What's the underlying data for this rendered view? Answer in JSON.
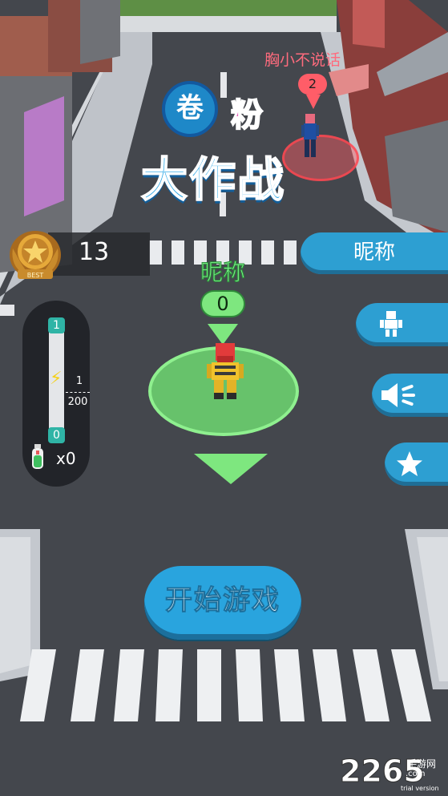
{
  "title": {
    "circle_char": "卷",
    "line1_char": "粉",
    "line2": "大作战"
  },
  "opponent": {
    "name": "胸小不说话",
    "score": "2"
  },
  "best_score": {
    "badge_text": "BEST",
    "value": "13"
  },
  "energy": {
    "max_label": "1",
    "min_label": "0",
    "fraction_numerator": "1",
    "fraction_denominator": "200",
    "level_fraction": 0.005
  },
  "potion": {
    "count": "x0"
  },
  "player": {
    "name": "昵称",
    "score": "0"
  },
  "side_menu": {
    "nickname_label": "昵称",
    "skin_icon": "character-icon",
    "sound_icon": "speaker-icon",
    "rate_icon": "star-icon"
  },
  "start_button": {
    "label": "开始游戏"
  },
  "watermark": {
    "number": "2265",
    "cn_text": "手游网",
    "url": ".com",
    "trial": "trial version"
  },
  "colors": {
    "accent_blue": "#2d9fd2",
    "player_green": "#7ee77f",
    "enemy_red": "#ff5d68",
    "road": "#46494f"
  }
}
